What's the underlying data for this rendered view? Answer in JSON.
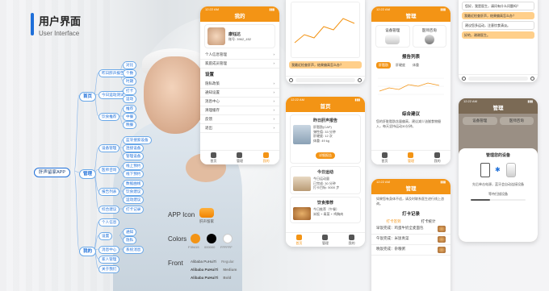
{
  "title": {
    "cn": "用户界面",
    "en": "User Interface"
  },
  "mindmap": {
    "root": "肝声留家APP",
    "branches": [
      {
        "label": "首页",
        "subs": [
          {
            "label": "昨日肝声报告",
            "leaves": [
              "对比",
              "个数",
              "时期"
            ]
          },
          {
            "label": "今日运动测试",
            "leaves": [
              "打卡",
              "运动"
            ]
          },
          {
            "label": "饮食推荐",
            "leaves": [
              "推荐",
              "中餐",
              "晚餐"
            ]
          }
        ]
      },
      {
        "label": "管理",
        "subs": [
          {
            "label": "设备管理",
            "leaves": [
              "蓝牙搜索设备",
              "连接设备",
              "管理设备"
            ]
          },
          {
            "label": "医师咨询",
            "leaves": [
              "线上预约",
              "线下预约"
            ]
          },
          {
            "label": "报告列表",
            "leaves": [
              "数据曲线",
              "饮食建议",
              "运动建议"
            ]
          },
          {
            "label": "综合建议",
            "leaves": [
              "打卡记录"
            ]
          }
        ]
      },
      {
        "label": "我的",
        "subs": [
          {
            "label": "个人信息",
            "leaves": []
          },
          {
            "label": "设置",
            "leaves": [
              "通知",
              "隐私"
            ]
          },
          {
            "label": "消息中心",
            "leaves": [
              "系统消息"
            ]
          },
          {
            "label": "家人管理",
            "leaves": []
          },
          {
            "label": "关于我们",
            "leaves": []
          }
        ]
      }
    ]
  },
  "legend": {
    "app_icon_label": "APP Icon",
    "app_icon_caption": "肝声留家",
    "colors_label": "Colors",
    "colors": [
      {
        "hex": "#F39415",
        "caption": "F39415"
      },
      {
        "hex": "#000000",
        "caption": "000000"
      },
      {
        "hex": "#FFFFFF",
        "caption": "FFFFFF"
      }
    ],
    "font_label": "Front",
    "fonts": [
      {
        "name": "Alibaba PuHuiTi",
        "weight": "Regular"
      },
      {
        "name": "Alibaba PuHuiTi",
        "weight": "Medium"
      },
      {
        "name": "Alibaba PuHuiTi",
        "weight": "Bold"
      }
    ],
    "accent": "#F39415"
  },
  "phones": {
    "time": "12:22 AM",
    "mine": {
      "title": "我的",
      "name": "康钰达",
      "id": "账号: 3962_452",
      "info_items": [
        "个人信息管理",
        "家庭成员管理"
      ],
      "settings_title": "设置",
      "settings_items": [
        "隐私政策",
        "通知设置",
        "消息中心",
        "清理缓存",
        "反馈",
        "退出"
      ]
    },
    "home": {
      "title": "首页",
      "report_title": "昨日肝声报告",
      "report_lines": [
        "肝脂肪(CAP)",
        "弹性值: 33 分钟",
        "肝硬度: 12 次",
        "体重: 49 kg"
      ],
      "report_btn": "详细报告",
      "exercise_title": "今日运动",
      "exercise_lines": [
        "今日运动量",
        "已完成: 30 分钟",
        "打卡目标: 5000 步"
      ],
      "diet_title": "饮食推荐",
      "diet_lines": [
        "今日推荐（午餐）",
        "米饭 + 青菜 + 鸡胸肉"
      ]
    },
    "manage": {
      "title": "管理",
      "device": "设备管理",
      "doctor": "医师咨询",
      "report_list": "报告列表",
      "chart_tabs": [
        "肝脂肪",
        "肝硬度",
        "体重"
      ],
      "advice_title": "综合建议",
      "advice_text": "您的肝脏脂肪含量偏高，建议减少油腻食物摄入，每天坚持运动30分钟。"
    },
    "device_mgr": {
      "title": "管理",
      "device": "设备管理",
      "doctor": "医师咨询",
      "manage_my_device": "管理您的设备",
      "hint": "先后单击电源，蓝牙会自动连接设备",
      "scan": "等待扫描设备"
    },
    "chat": {
      "messages": [
        {
          "side": "w",
          "text": "您好，我是医生，请问有什么问题吗？"
        },
        {
          "side": "o",
          "text": "我最近检查肝声，结果偏高怎么办？"
        },
        {
          "side": "w",
          "text": "建议您多运动，注意饮食清淡。"
        },
        {
          "side": "o",
          "text": "好的，谢谢医生。"
        }
      ]
    },
    "checkin": {
      "top_text": "如果您有身体不适，请及时联系医生进行线上咨询。",
      "title": "打卡记录",
      "tabs": [
        "打卡签到",
        "打卡统计"
      ],
      "entries": [
        "早饭完成：鸡蛋牛奶全麦面包",
        "午饭完成：米饭青菜",
        "晚饭完成：杂粮粥"
      ]
    },
    "tabs": [
      "首页",
      "管理",
      "我的"
    ]
  }
}
